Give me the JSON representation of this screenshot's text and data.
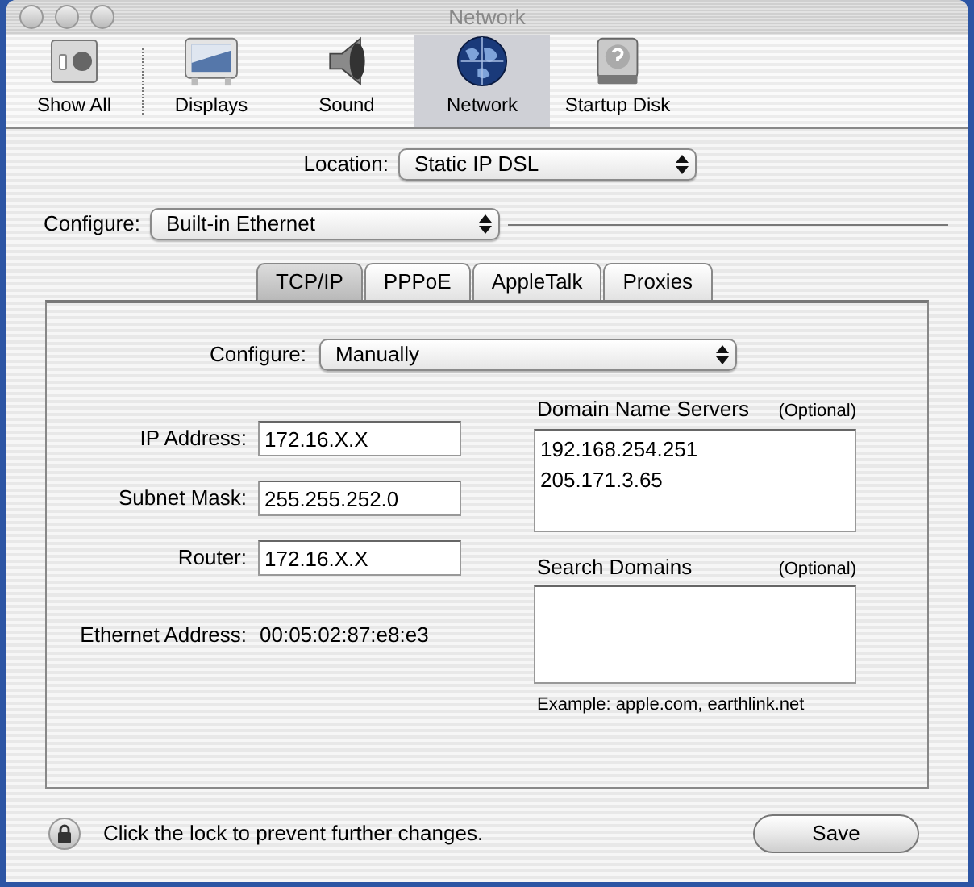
{
  "window": {
    "title": "Network"
  },
  "toolbar": [
    {
      "label": "Show All",
      "kind": "showall",
      "selected": false
    },
    {
      "label": "Displays",
      "kind": "displays",
      "selected": false
    },
    {
      "label": "Sound",
      "kind": "sound",
      "selected": false
    },
    {
      "label": "Network",
      "kind": "network",
      "selected": true
    },
    {
      "label": "Startup Disk",
      "kind": "disk",
      "selected": false
    }
  ],
  "location": {
    "label": "Location:",
    "value": "Static IP DSL"
  },
  "configure": {
    "label": "Configure:",
    "value": "Built-in Ethernet"
  },
  "tabs": [
    {
      "label": "TCP/IP",
      "selected": true
    },
    {
      "label": "PPPoE",
      "selected": false
    },
    {
      "label": "AppleTalk",
      "selected": false
    },
    {
      "label": "Proxies",
      "selected": false
    }
  ],
  "tcpip": {
    "configure": {
      "label": "Configure:",
      "value": "Manually"
    },
    "fields": [
      {
        "label": "IP Address:",
        "value": "172.16.X.X"
      },
      {
        "label": "Subnet Mask:",
        "value": "255.255.252.0"
      },
      {
        "label": "Router:",
        "value": "172.16.X.X"
      }
    ],
    "ethernet": {
      "label": "Ethernet Address:",
      "value": "00:05:02:87:e8:e3"
    },
    "dns": {
      "title": "Domain Name Servers",
      "note": "(Optional)",
      "entries": [
        "192.168.254.251",
        "205.171.3.65"
      ]
    },
    "search_domains": {
      "title": "Search Domains",
      "note": "(Optional)",
      "example": "Example: apple.com, earthlink.net"
    }
  },
  "lock": {
    "text": "Click the lock to prevent further changes."
  },
  "buttons": [
    "Save"
  ]
}
